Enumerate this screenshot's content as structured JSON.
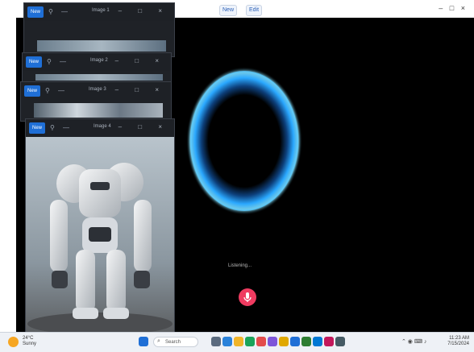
{
  "top_bar": {
    "btn_a": "New",
    "btn_b": "Edit",
    "window_controls": "– □ ×"
  },
  "main_app": {
    "caption": "Listening...",
    "mic_label": "mic-icon"
  },
  "windows": [
    {
      "new_label": "New",
      "title": "Image 1"
    },
    {
      "new_label": "New",
      "title": "Image 2"
    },
    {
      "new_label": "New",
      "title": "Image 3"
    },
    {
      "new_label": "New",
      "title": "Image 4"
    }
  ],
  "taskbar": {
    "weather_line1": "24°C",
    "weather_line2": "Sunny",
    "search_placeholder": "Search",
    "clock_time": "11:23 AM",
    "clock_date": "7/15/2024"
  },
  "colors": {
    "ring_blue": "#2aa8ff",
    "mic_pink": "#ef3b60",
    "win_blue": "#1f6fd6"
  }
}
